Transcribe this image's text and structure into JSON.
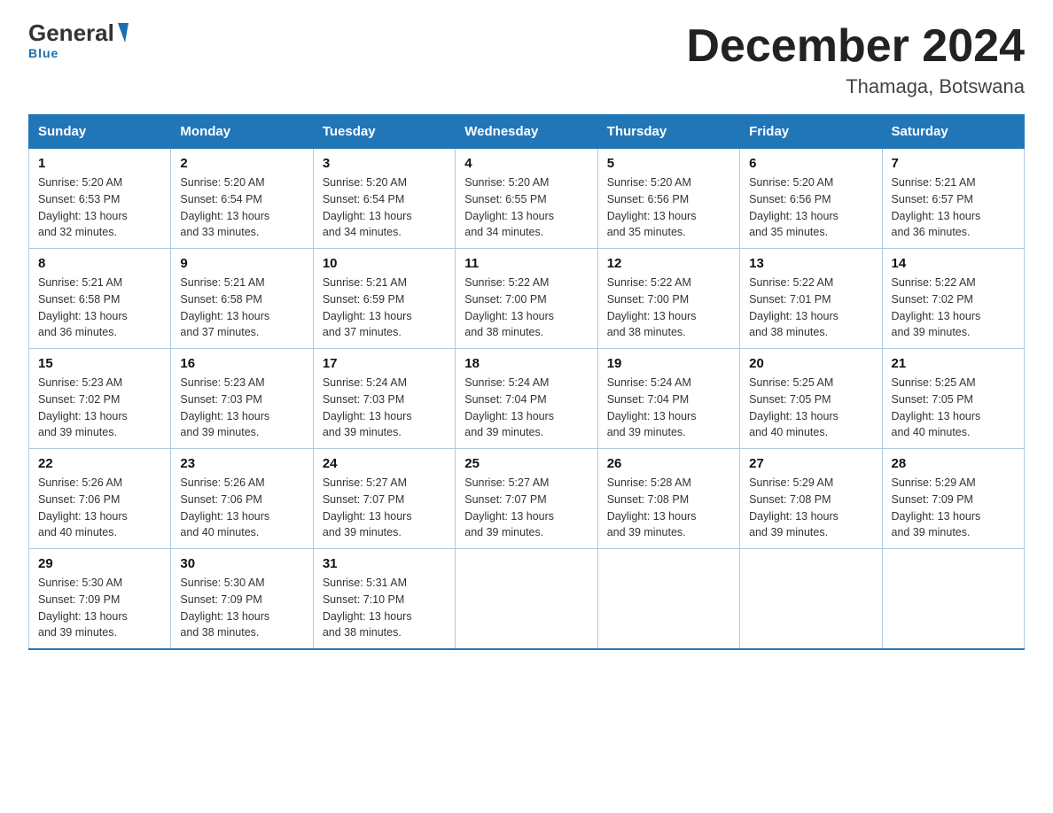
{
  "logo": {
    "general": "General",
    "blue": "Blue",
    "tagline": "Blue"
  },
  "title": "December 2024",
  "subtitle": "Thamaga, Botswana",
  "days_of_week": [
    "Sunday",
    "Monday",
    "Tuesday",
    "Wednesday",
    "Thursday",
    "Friday",
    "Saturday"
  ],
  "weeks": [
    [
      {
        "day": "1",
        "sunrise": "5:20 AM",
        "sunset": "6:53 PM",
        "daylight": "13 hours and 32 minutes."
      },
      {
        "day": "2",
        "sunrise": "5:20 AM",
        "sunset": "6:54 PM",
        "daylight": "13 hours and 33 minutes."
      },
      {
        "day": "3",
        "sunrise": "5:20 AM",
        "sunset": "6:54 PM",
        "daylight": "13 hours and 34 minutes."
      },
      {
        "day": "4",
        "sunrise": "5:20 AM",
        "sunset": "6:55 PM",
        "daylight": "13 hours and 34 minutes."
      },
      {
        "day": "5",
        "sunrise": "5:20 AM",
        "sunset": "6:56 PM",
        "daylight": "13 hours and 35 minutes."
      },
      {
        "day": "6",
        "sunrise": "5:20 AM",
        "sunset": "6:56 PM",
        "daylight": "13 hours and 35 minutes."
      },
      {
        "day": "7",
        "sunrise": "5:21 AM",
        "sunset": "6:57 PM",
        "daylight": "13 hours and 36 minutes."
      }
    ],
    [
      {
        "day": "8",
        "sunrise": "5:21 AM",
        "sunset": "6:58 PM",
        "daylight": "13 hours and 36 minutes."
      },
      {
        "day": "9",
        "sunrise": "5:21 AM",
        "sunset": "6:58 PM",
        "daylight": "13 hours and 37 minutes."
      },
      {
        "day": "10",
        "sunrise": "5:21 AM",
        "sunset": "6:59 PM",
        "daylight": "13 hours and 37 minutes."
      },
      {
        "day": "11",
        "sunrise": "5:22 AM",
        "sunset": "7:00 PM",
        "daylight": "13 hours and 38 minutes."
      },
      {
        "day": "12",
        "sunrise": "5:22 AM",
        "sunset": "7:00 PM",
        "daylight": "13 hours and 38 minutes."
      },
      {
        "day": "13",
        "sunrise": "5:22 AM",
        "sunset": "7:01 PM",
        "daylight": "13 hours and 38 minutes."
      },
      {
        "day": "14",
        "sunrise": "5:22 AM",
        "sunset": "7:02 PM",
        "daylight": "13 hours and 39 minutes."
      }
    ],
    [
      {
        "day": "15",
        "sunrise": "5:23 AM",
        "sunset": "7:02 PM",
        "daylight": "13 hours and 39 minutes."
      },
      {
        "day": "16",
        "sunrise": "5:23 AM",
        "sunset": "7:03 PM",
        "daylight": "13 hours and 39 minutes."
      },
      {
        "day": "17",
        "sunrise": "5:24 AM",
        "sunset": "7:03 PM",
        "daylight": "13 hours and 39 minutes."
      },
      {
        "day": "18",
        "sunrise": "5:24 AM",
        "sunset": "7:04 PM",
        "daylight": "13 hours and 39 minutes."
      },
      {
        "day": "19",
        "sunrise": "5:24 AM",
        "sunset": "7:04 PM",
        "daylight": "13 hours and 39 minutes."
      },
      {
        "day": "20",
        "sunrise": "5:25 AM",
        "sunset": "7:05 PM",
        "daylight": "13 hours and 40 minutes."
      },
      {
        "day": "21",
        "sunrise": "5:25 AM",
        "sunset": "7:05 PM",
        "daylight": "13 hours and 40 minutes."
      }
    ],
    [
      {
        "day": "22",
        "sunrise": "5:26 AM",
        "sunset": "7:06 PM",
        "daylight": "13 hours and 40 minutes."
      },
      {
        "day": "23",
        "sunrise": "5:26 AM",
        "sunset": "7:06 PM",
        "daylight": "13 hours and 40 minutes."
      },
      {
        "day": "24",
        "sunrise": "5:27 AM",
        "sunset": "7:07 PM",
        "daylight": "13 hours and 39 minutes."
      },
      {
        "day": "25",
        "sunrise": "5:27 AM",
        "sunset": "7:07 PM",
        "daylight": "13 hours and 39 minutes."
      },
      {
        "day": "26",
        "sunrise": "5:28 AM",
        "sunset": "7:08 PM",
        "daylight": "13 hours and 39 minutes."
      },
      {
        "day": "27",
        "sunrise": "5:29 AM",
        "sunset": "7:08 PM",
        "daylight": "13 hours and 39 minutes."
      },
      {
        "day": "28",
        "sunrise": "5:29 AM",
        "sunset": "7:09 PM",
        "daylight": "13 hours and 39 minutes."
      }
    ],
    [
      {
        "day": "29",
        "sunrise": "5:30 AM",
        "sunset": "7:09 PM",
        "daylight": "13 hours and 39 minutes."
      },
      {
        "day": "30",
        "sunrise": "5:30 AM",
        "sunset": "7:09 PM",
        "daylight": "13 hours and 38 minutes."
      },
      {
        "day": "31",
        "sunrise": "5:31 AM",
        "sunset": "7:10 PM",
        "daylight": "13 hours and 38 minutes."
      },
      null,
      null,
      null,
      null
    ]
  ],
  "labels": {
    "sunrise": "Sunrise:",
    "sunset": "Sunset:",
    "daylight": "Daylight:"
  }
}
